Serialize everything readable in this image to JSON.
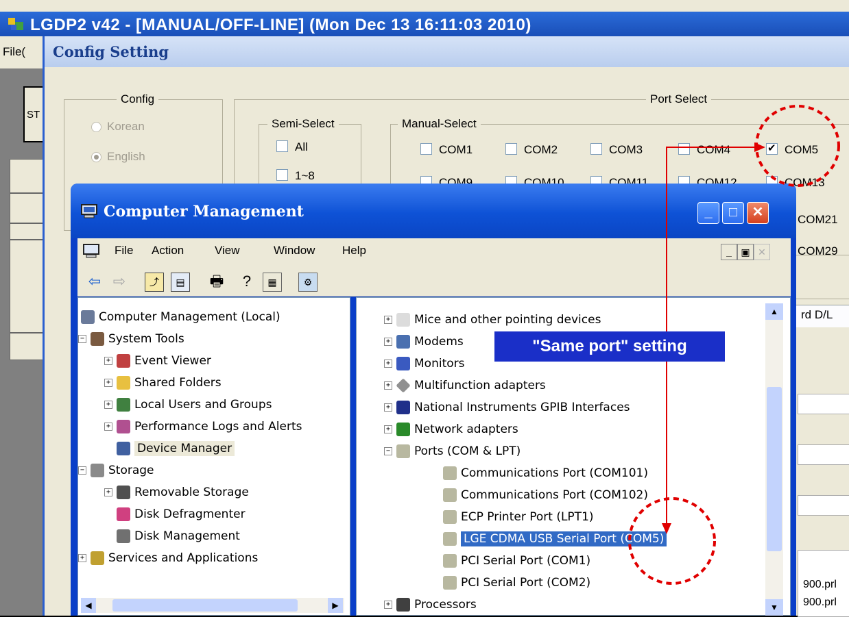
{
  "lgdp": {
    "title": "LGDP2 v42 - [MANUAL/OFF-LINE] (Mon Dec 13 16:11:03 2010)",
    "menu_file": "File(",
    "st_label": "ST"
  },
  "config": {
    "title": "Config Setting",
    "config_group": "Config",
    "korean": "Korean",
    "english": "English",
    "port_select": "Port Select",
    "semi_select": "Semi-Select",
    "semi_all": "All",
    "semi_1_8": "1~8",
    "manual_select": "Manual-Select",
    "ports_row1": [
      "COM1",
      "COM2",
      "COM3",
      "COM4",
      "COM5"
    ],
    "ports_row2": [
      "COM9",
      "COM10",
      "COM11",
      "COM12",
      "COM13"
    ],
    "ports_col_extra": [
      "COM21",
      "COM29"
    ],
    "tab_partial": "rd D/L",
    "file_list": [
      "900.prl",
      "900.prl"
    ]
  },
  "cm": {
    "title": "Computer Management",
    "menu": [
      "File",
      "Action",
      "View",
      "Window",
      "Help"
    ],
    "tree": [
      {
        "label": "Computer Management (Local)",
        "icon": "computer-icon"
      },
      {
        "label": "System Tools",
        "icon": "tools-icon"
      },
      {
        "label": "Event Viewer",
        "icon": "event-viewer-icon"
      },
      {
        "label": "Shared Folders",
        "icon": "folder-icon"
      },
      {
        "label": "Local Users and Groups",
        "icon": "users-icon"
      },
      {
        "label": "Performance Logs and Alerts",
        "icon": "performance-icon"
      },
      {
        "label": "Device Manager",
        "icon": "device-manager-icon"
      },
      {
        "label": "Storage",
        "icon": "storage-icon"
      },
      {
        "label": "Removable Storage",
        "icon": "removable-storage-icon"
      },
      {
        "label": "Disk Defragmenter",
        "icon": "defrag-icon"
      },
      {
        "label": "Disk Management",
        "icon": "disk-icon"
      },
      {
        "label": "Services and Applications",
        "icon": "services-icon"
      }
    ],
    "devices": [
      {
        "label": "Mice and other pointing devices",
        "icon": "mouse-icon"
      },
      {
        "label": "Modems",
        "icon": "modem-icon"
      },
      {
        "label": "Monitors",
        "icon": "monitor-icon"
      },
      {
        "label": "Multifunction adapters",
        "icon": "adapter-icon"
      },
      {
        "label": "National Instruments GPIB Interfaces",
        "icon": "gpib-icon"
      },
      {
        "label": "Network adapters",
        "icon": "network-icon"
      },
      {
        "label": "Ports (COM & LPT)",
        "icon": "port-icon"
      },
      {
        "label": "Communications Port (COM101)",
        "icon": "port-icon"
      },
      {
        "label": "Communications Port (COM102)",
        "icon": "port-icon"
      },
      {
        "label": "ECP Printer Port (LPT1)",
        "icon": "port-icon"
      },
      {
        "label": "LGE CDMA USB Serial Port (COM5)",
        "icon": "port-icon"
      },
      {
        "label": "PCI Serial Port (COM1)",
        "icon": "port-icon"
      },
      {
        "label": "PCI Serial Port (COM2)",
        "icon": "port-icon"
      },
      {
        "label": "Processors",
        "icon": "processor-icon"
      }
    ]
  },
  "annotation": {
    "banner": "\"Same port\" setting",
    "accent": "#e00000",
    "banner_color": "#1a2fc8"
  }
}
